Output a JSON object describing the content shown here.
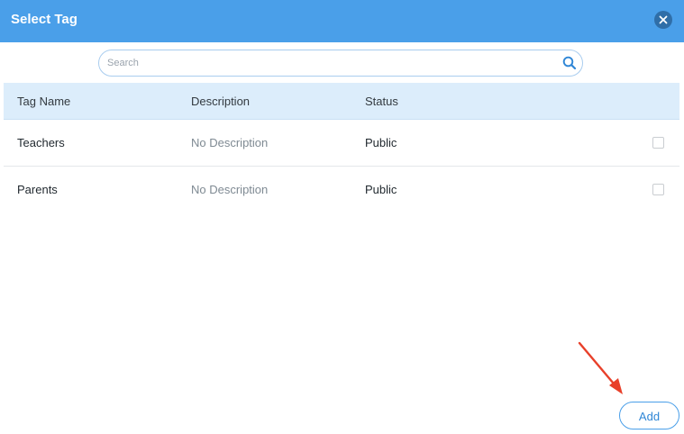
{
  "dialog": {
    "title": "Select Tag",
    "close_icon": "close-icon"
  },
  "search": {
    "placeholder": "Search",
    "value": "",
    "icon": "search-icon"
  },
  "table": {
    "headers": {
      "tag_name": "Tag Name",
      "description": "Description",
      "status": "Status"
    },
    "rows": [
      {
        "tag_name": "Teachers",
        "description": "No Description",
        "status": "Public",
        "checked": false
      },
      {
        "tag_name": "Parents",
        "description": "No Description",
        "status": "Public",
        "checked": false
      }
    ]
  },
  "footer": {
    "add_label": "Add"
  },
  "colors": {
    "header_bg": "#4a9fe9",
    "table_header_bg": "#dcedfb",
    "annotation_arrow": "#e8402a"
  }
}
